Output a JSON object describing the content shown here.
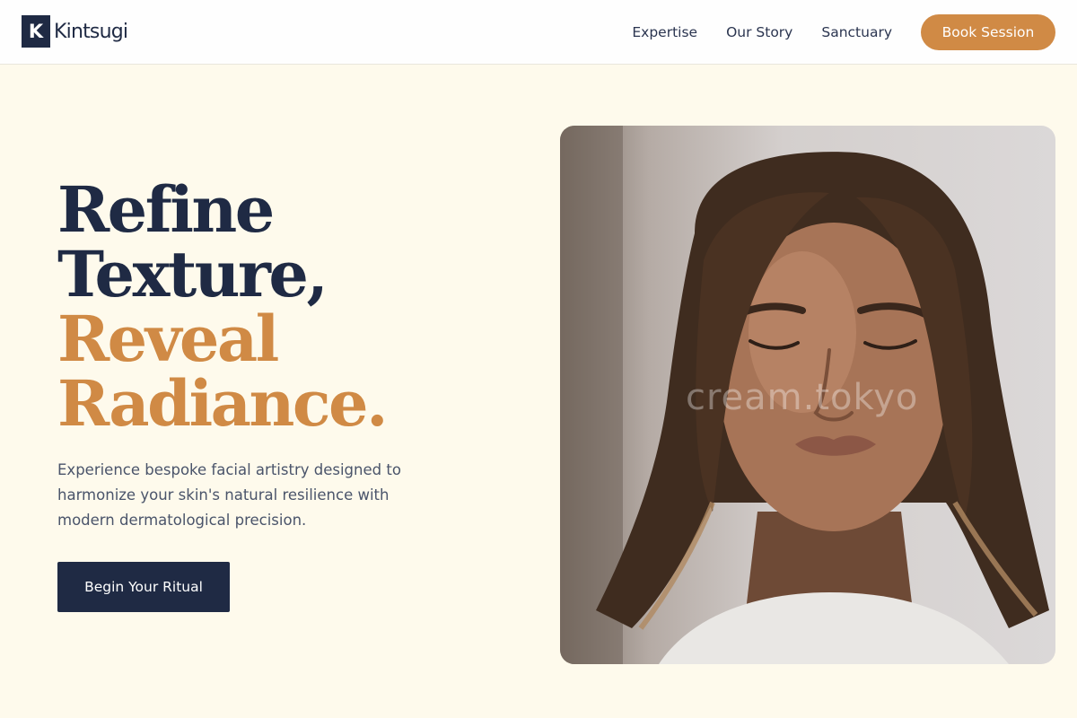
{
  "brand": {
    "logo_letter": "K",
    "name": "Kintsugi"
  },
  "nav": {
    "links": [
      "Expertise",
      "Our Story",
      "Sanctuary"
    ],
    "cta_label": "Book Session"
  },
  "hero": {
    "headline": {
      "line1": "Refine",
      "line2": "Texture,",
      "line3": "Reveal",
      "line4": "Radiance."
    },
    "subcopy": "Experience bespoke facial artistry designed to harmonize your skin's natural resilience with modern dermatological precision.",
    "cta_label": "Begin Your Ritual",
    "photo_watermark": "cream.tokyo"
  },
  "colors": {
    "navy": "#1f2a44",
    "accent": "#d08a45",
    "cream_background": "#fefaec"
  }
}
